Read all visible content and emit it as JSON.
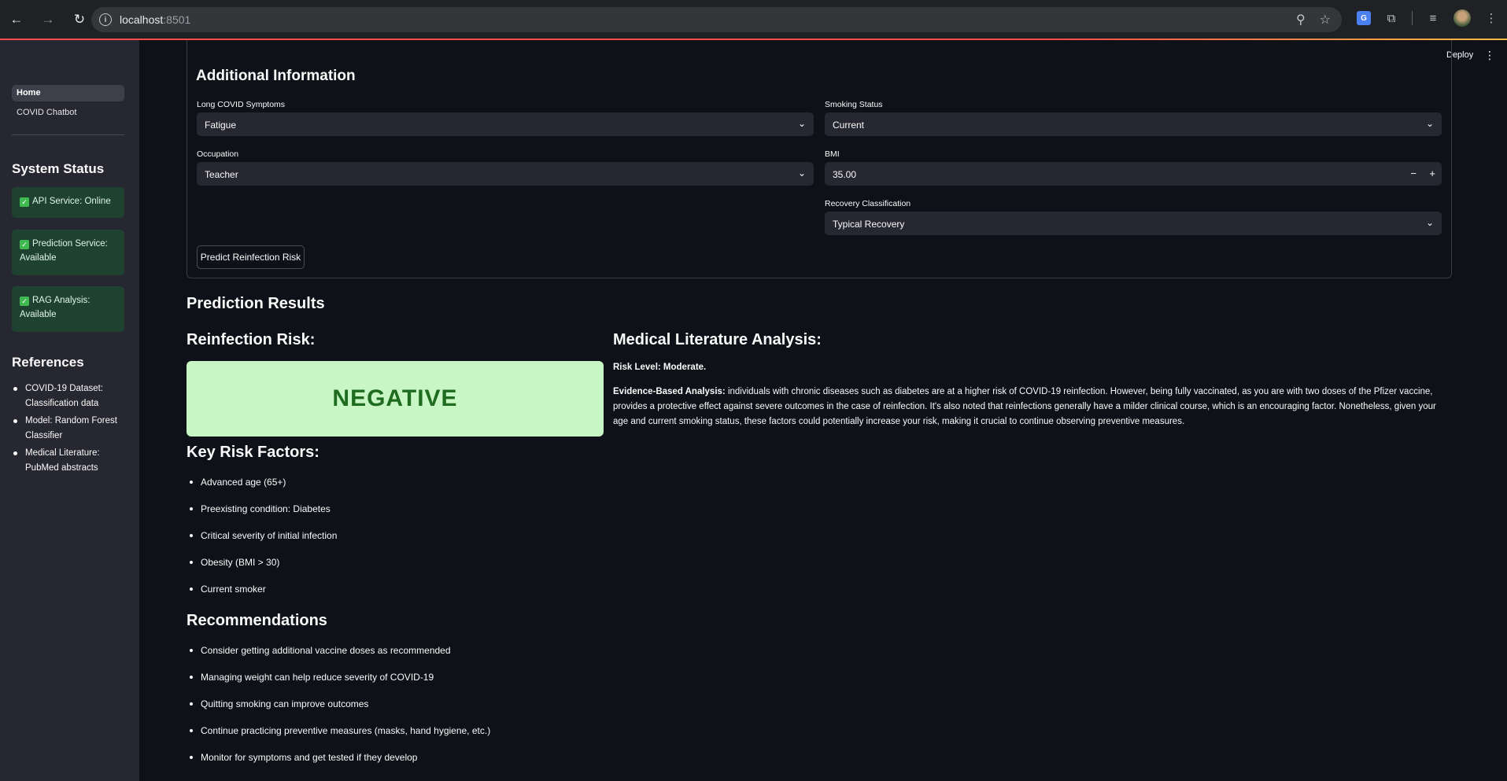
{
  "browser": {
    "url_host": "localhost",
    "url_port": ":8501"
  },
  "sidebar": {
    "nav": [
      {
        "label": "Home"
      },
      {
        "label": "COVID Chatbot"
      }
    ],
    "status_title": "System Status",
    "status": [
      {
        "label": "API Service: Online"
      },
      {
        "label": "Prediction Service: Available"
      },
      {
        "label": "RAG Analysis: Available"
      }
    ],
    "references_title": "References",
    "references": [
      {
        "label": "COVID-19 Dataset: Classification data"
      },
      {
        "label": "Model: Random Forest Classifier"
      },
      {
        "label": "Medical Literature: PubMed abstracts"
      }
    ]
  },
  "header": {
    "deploy_label": "Deploy"
  },
  "form": {
    "title": "Additional Information",
    "long_covid": {
      "label": "Long COVID Symptoms",
      "value": "Fatigue"
    },
    "smoking": {
      "label": "Smoking Status",
      "value": "Current"
    },
    "occupation": {
      "label": "Occupation",
      "value": "Teacher"
    },
    "bmi": {
      "label": "BMI",
      "value": "35.00",
      "minus": "−",
      "plus": "+"
    },
    "recovery": {
      "label": "Recovery Classification",
      "value": "Typical Recovery"
    },
    "submit_label": "Predict Reinfection Risk"
  },
  "results": {
    "title": "Prediction Results",
    "risk_title": "Reinfection Risk:",
    "risk_value": "NEGATIVE",
    "risk_color": "#c8f7c5",
    "factors_title": "Key Risk Factors:",
    "factors": [
      "Advanced age (65+)",
      "Preexisting condition: Diabetes",
      "Critical severity of initial infection",
      "Obesity (BMI > 30)",
      "Current smoker"
    ],
    "recommendations_title": "Recommendations",
    "recommendations": [
      "Consider getting additional vaccine doses as recommended",
      "Managing weight can help reduce severity of COVID-19",
      "Quitting smoking can improve outcomes",
      "Continue practicing preventive measures (masks, hand hygiene, etc.)",
      "Monitor for symptoms and get tested if they develop"
    ],
    "literature_title": "Medical Literature Analysis:",
    "risk_level": "Risk Level: Moderate.",
    "evidence_label": "Evidence-Based Analysis:",
    "evidence_text": " individuals with chronic diseases such as diabetes are at a higher risk of COVID-19 reinfection. However, being fully vaccinated, as you are with two doses of the Pfizer vaccine, provides a protective effect against severe outcomes in the case of reinfection. It's also noted that reinfections generally have a milder clinical course, which is an encouraging factor. Nonetheless, given your age and current smoking status, these factors could potentially increase your risk, making it crucial to continue observing preventive measures."
  }
}
